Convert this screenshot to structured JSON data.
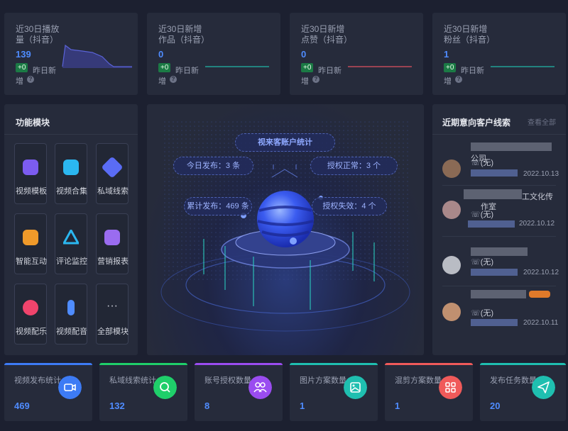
{
  "stats": [
    {
      "title": "近30日播放量（抖音）",
      "value": "139",
      "badge": "+0",
      "delta_label": "昨日新",
      "delta_label2": "增",
      "line_color": "#4b57c8"
    },
    {
      "title": "近30日新增作品（抖音）",
      "value": "0",
      "badge": "+0",
      "delta_label": "昨日新",
      "delta_label2": "增",
      "line_color": "#21b8a8"
    },
    {
      "title": "近30日新增点赞（抖音）",
      "value": "0",
      "badge": "+0",
      "delta_label": "昨日新",
      "delta_label2": "增",
      "line_color": "#e0525f"
    },
    {
      "title": "近30日新增粉丝（抖音）",
      "value": "1",
      "badge": "+0",
      "delta_label": "昨日新",
      "delta_label2": "增",
      "line_color": "#21b8a8"
    }
  ],
  "modules": {
    "title": "功能模块",
    "items": [
      {
        "label": "视频模板",
        "icon": "video-template-icon",
        "color": "#7c5cf0"
      },
      {
        "label": "视频合集",
        "icon": "video-collection-icon",
        "color": "#2bb7f0"
      },
      {
        "label": "私域线索",
        "icon": "private-leads-icon",
        "color": "#5a6cf5"
      },
      {
        "label": "智能互动",
        "icon": "smart-interaction-icon",
        "color": "#f09a2a"
      },
      {
        "label": "评论监控",
        "icon": "comment-monitor-icon",
        "color": "#2bb7f0"
      },
      {
        "label": "营销报表",
        "icon": "marketing-report-icon",
        "color": "#9a6cf0"
      },
      {
        "label": "视频配乐",
        "icon": "music-icon",
        "color": "#f0446c"
      },
      {
        "label": "视频配音",
        "icon": "microphone-icon",
        "color": "#4f8cff"
      },
      {
        "label": "全部模块",
        "icon": "more-icon",
        "color": "#c8cbd6"
      }
    ]
  },
  "center": {
    "title": "视来客账户统计",
    "today_label": "今日发布：",
    "today_value": "3",
    "today_unit": "条",
    "auth_ok_label": "授权正常：",
    "auth_ok_value": "3",
    "auth_ok_unit": "个",
    "total_label": "累计发布：",
    "total_value": "469",
    "total_unit": "条",
    "auth_fail_label": "授权失效：",
    "auth_fail_value": "4",
    "auth_fail_unit": "个"
  },
  "leads": {
    "title": "近期意向客户线索",
    "view_all": "查看全部",
    "items": [
      {
        "name": "公司",
        "phone": "(无)",
        "date": "2022.10.13",
        "avatar_color": "#8a6a55"
      },
      {
        "name": "工文化传",
        "name2": "作室",
        "phone": "(无)",
        "date": "2022.10.12",
        "avatar_color": "#a9888a"
      },
      {
        "name": "",
        "phone": "(无)",
        "date": "2022.10.12",
        "avatar_color": "#b9bcc4"
      },
      {
        "name": "",
        "phone": "(无)",
        "date": "2022.10.11",
        "avatar_color": "#c09070"
      }
    ]
  },
  "bottom": [
    {
      "title": "视频发布统计",
      "value": "469",
      "color": "#3d7bf5",
      "icon": "video-camera-icon"
    },
    {
      "title": "私域线索统计",
      "value": "132",
      "color": "#1fcf6a",
      "icon": "search-icon"
    },
    {
      "title": "账号授权数量",
      "value": "8",
      "color": "#9a4cf0",
      "icon": "users-icon"
    },
    {
      "title": "图片方案数量",
      "value": "1",
      "color": "#1fbfb0",
      "icon": "image-icon"
    },
    {
      "title": "混剪方案数量",
      "value": "1",
      "color": "#f05a5a",
      "icon": "grid-icon"
    },
    {
      "title": "发布任务数量",
      "value": "20",
      "color": "#1fbfb0",
      "icon": "send-icon"
    }
  ]
}
